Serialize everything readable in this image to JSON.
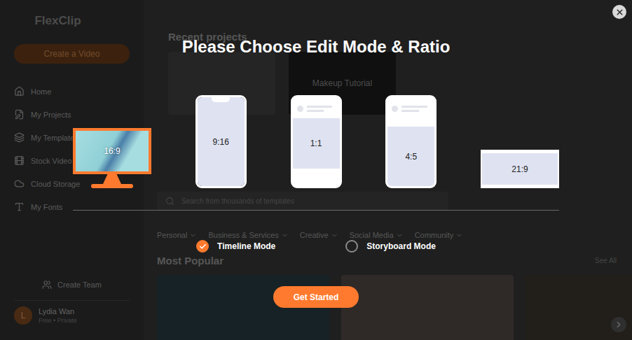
{
  "sidebar": {
    "logo": "FlexClip",
    "create_button": "Create a Video",
    "items": [
      {
        "label": "Home",
        "selected": false
      },
      {
        "label": "My Projects",
        "selected": false
      },
      {
        "label": "My Templates",
        "selected": false
      },
      {
        "label": "Stock Video",
        "selected": false
      },
      {
        "label": "Cloud Storage",
        "selected": false
      },
      {
        "label": "My Fonts",
        "selected": false
      }
    ],
    "team_button": "Create Team",
    "user": {
      "avatar": "L",
      "name": "Lydia Wan",
      "plan": "Free • Private"
    }
  },
  "recent": {
    "title": "Recent projects",
    "featured_project": "Makeup Tutorial"
  },
  "search": {
    "placeholder": "Search from thousands of templates"
  },
  "categories": [
    "Personal",
    "Business & Services",
    "Creative",
    "Social Media",
    "Community"
  ],
  "popular": {
    "title": "Most Popular",
    "link": "See All"
  },
  "modal": {
    "title": "Please Choose Edit Mode & Ratio",
    "ratios": [
      {
        "label": "16:9",
        "kind": "monitor",
        "selected": true
      },
      {
        "label": "9:16",
        "kind": "tall",
        "selected": false
      },
      {
        "label": "1:1",
        "kind": "square",
        "selected": false
      },
      {
        "label": "4:5",
        "kind": "portrait",
        "selected": false
      },
      {
        "label": "21:9",
        "kind": "wide",
        "selected": false
      }
    ],
    "modes": [
      {
        "label": "Timeline Mode",
        "selected": true
      },
      {
        "label": "Storyboard Mode",
        "selected": false
      }
    ],
    "button": "Get Started"
  }
}
